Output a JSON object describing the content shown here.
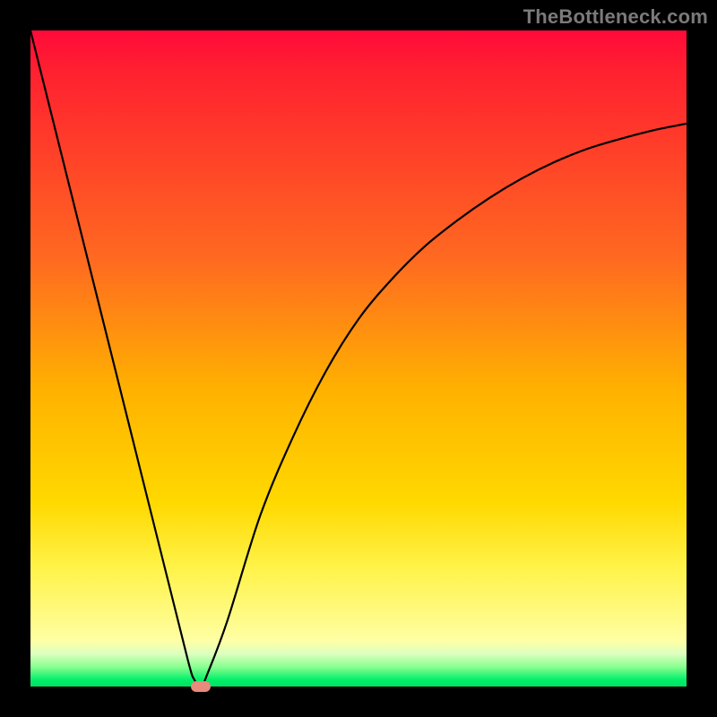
{
  "watermark": {
    "text": "TheBottleneck.com"
  },
  "chart_data": {
    "type": "line",
    "title": "",
    "xlabel": "",
    "ylabel": "",
    "xlim": [
      0,
      100
    ],
    "ylim": [
      0,
      100
    ],
    "series": [
      {
        "name": "curve",
        "x": [
          0,
          5,
          10,
          15,
          20,
          24,
          25,
          26,
          27,
          30,
          35,
          40,
          45,
          50,
          55,
          60,
          65,
          70,
          75,
          80,
          85,
          90,
          95,
          100
        ],
        "values": [
          100,
          80,
          60,
          40,
          20,
          4,
          1,
          0,
          2,
          10,
          26,
          38,
          48,
          56,
          62,
          67,
          71,
          74.5,
          77.5,
          80,
          82,
          83.5,
          84.8,
          85.8
        ]
      }
    ],
    "marker": {
      "x": 26,
      "y": 0
    },
    "background_gradient": {
      "top": "#ff0a3a",
      "bottom": "#00e060"
    }
  }
}
